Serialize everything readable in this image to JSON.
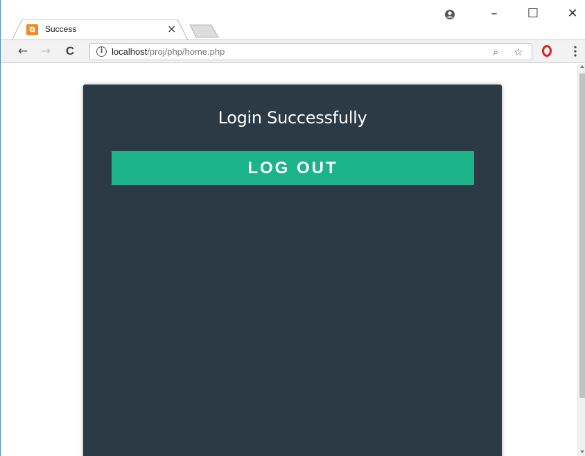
{
  "browser": {
    "tab": {
      "favicon_glyph": "⧉",
      "title": "Success",
      "close_glyph": "×"
    },
    "window_controls": {
      "minimize": "–",
      "maximize": "☐",
      "close": "✕"
    },
    "toolbar": {
      "back_glyph": "←",
      "forward_glyph": "→",
      "reload_glyph": "C",
      "info_glyph": "i",
      "url_host": "localhost",
      "url_path": "/proj/php/home.php",
      "zoom_glyph": "⌕",
      "star_glyph": "☆"
    },
    "icons": {
      "profile": "profile-icon",
      "opera": "opera-icon",
      "menu": "menu-dots-icon"
    },
    "colors": {
      "favicon": "#f08a24",
      "opera": "#e0201b"
    }
  },
  "page": {
    "title": "Login Successfully",
    "logout_label": "LOG OUT",
    "colors": {
      "card_background": "#2c3a45",
      "button_background": "#1bb38a",
      "text": "#ffffff"
    }
  }
}
